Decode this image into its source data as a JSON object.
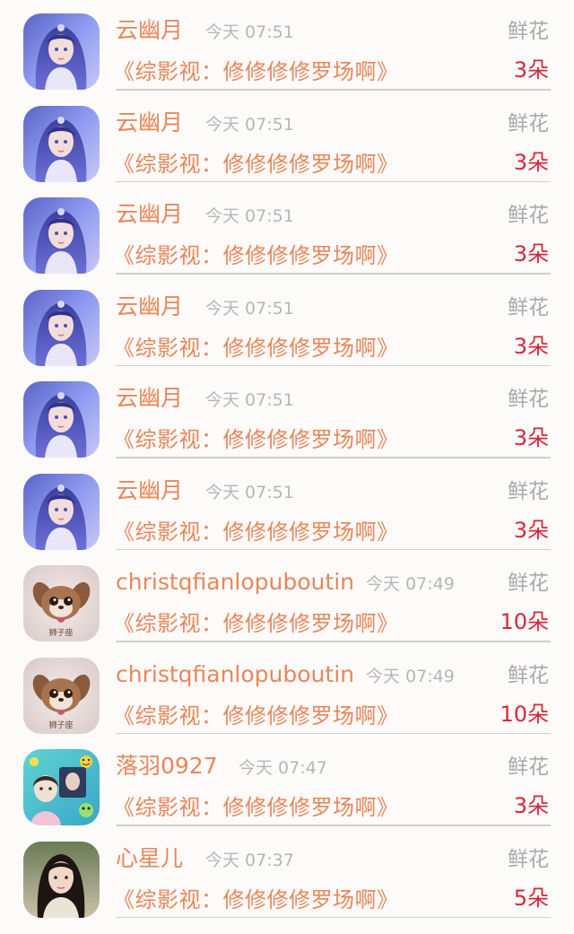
{
  "rows": [
    {
      "name": "云幽月",
      "time": "今天 07:51",
      "gift_label": "鲜花",
      "book_title": "《综影视：修修修修罗场啊》",
      "count": "3朵",
      "avatar_icon": "fairy-avatar-icon"
    },
    {
      "name": "云幽月",
      "time": "今天 07:51",
      "gift_label": "鲜花",
      "book_title": "《综影视：修修修修罗场啊》",
      "count": "3朵",
      "avatar_icon": "fairy-avatar-icon"
    },
    {
      "name": "云幽月",
      "time": "今天 07:51",
      "gift_label": "鲜花",
      "book_title": "《综影视：修修修修罗场啊》",
      "count": "3朵",
      "avatar_icon": "fairy-avatar-icon"
    },
    {
      "name": "云幽月",
      "time": "今天 07:51",
      "gift_label": "鲜花",
      "book_title": "《综影视：修修修修罗场啊》",
      "count": "3朵",
      "avatar_icon": "fairy-avatar-icon"
    },
    {
      "name": "云幽月",
      "time": "今天 07:51",
      "gift_label": "鲜花",
      "book_title": "《综影视：修修修修罗场啊》",
      "count": "3朵",
      "avatar_icon": "fairy-avatar-icon"
    },
    {
      "name": "云幽月",
      "time": "今天 07:51",
      "gift_label": "鲜花",
      "book_title": "《综影视：修修修修罗场啊》",
      "count": "3朵",
      "avatar_icon": "fairy-avatar-icon"
    },
    {
      "name": "christqfianlopuboutin",
      "time": "今天 07:49",
      "gift_label": "鲜花",
      "book_title": "《综影视：修修修修罗场啊》",
      "count": "10朵",
      "avatar_icon": "puppy-avatar-icon"
    },
    {
      "name": "christqfianlopuboutin",
      "time": "今天 07:49",
      "gift_label": "鲜花",
      "book_title": "《综影视：修修修修罗场啊》",
      "count": "10朵",
      "avatar_icon": "puppy-avatar-icon"
    },
    {
      "name": "落羽0927",
      "time": "今天 07:47",
      "gift_label": "鲜花",
      "book_title": "《综影视：修修修修罗场啊》",
      "count": "3朵",
      "avatar_icon": "collage-avatar-icon"
    },
    {
      "name": "心星儿",
      "time": "今天 07:37",
      "gift_label": "鲜花",
      "book_title": "《综影视：修修修修罗场啊》",
      "count": "5朵",
      "avatar_icon": "portrait-avatar-icon"
    }
  ],
  "colors": {
    "accent": "#e7875a",
    "count_red": "#d7283a",
    "muted": "#b6b6b6",
    "background": "#fdfafa"
  }
}
